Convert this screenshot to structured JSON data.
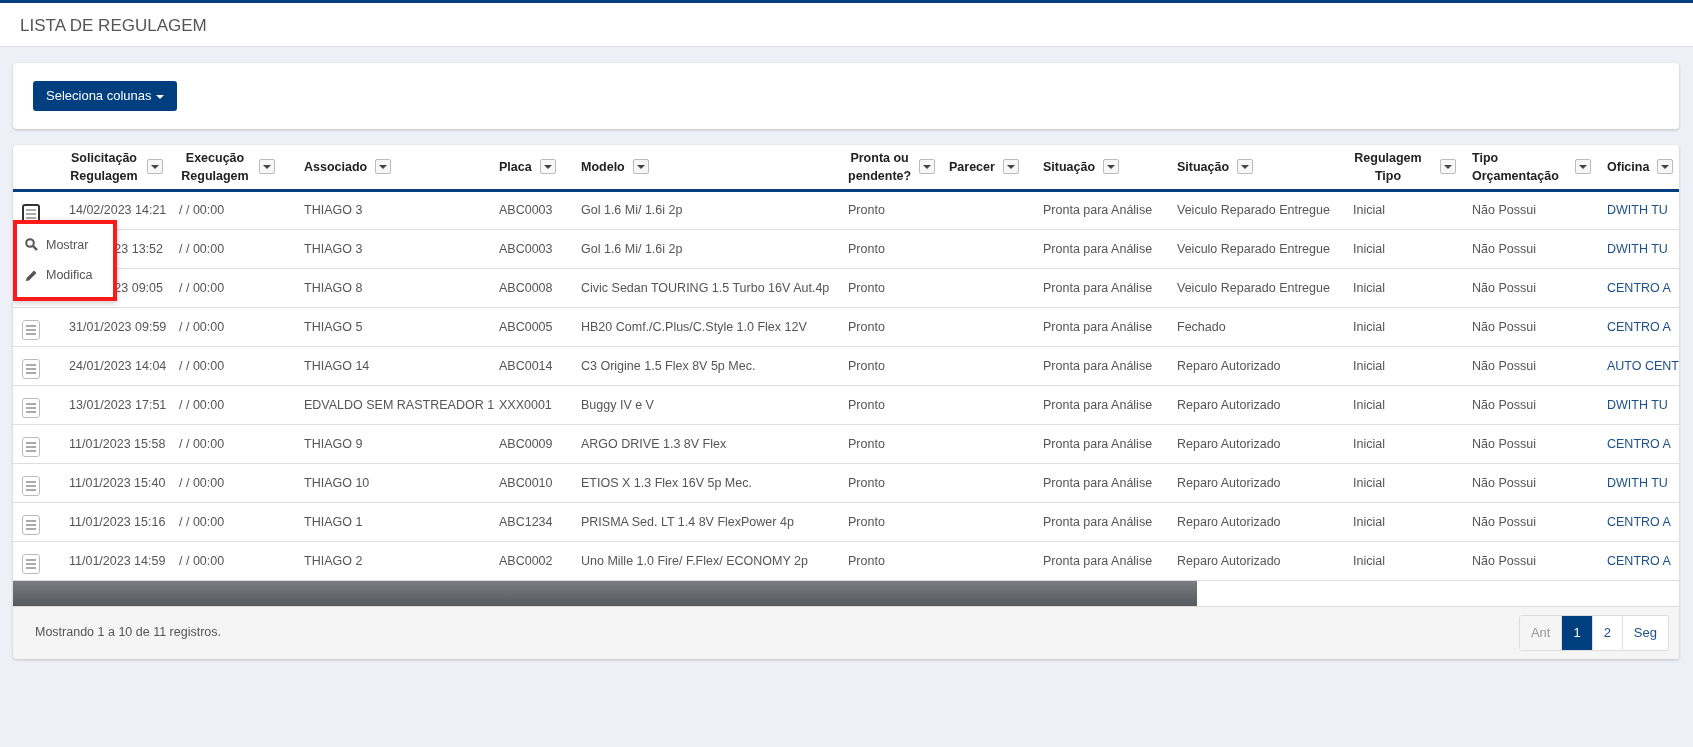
{
  "page_title": "LISTA DE REGULAGEM",
  "columns_button": "Seleciona colunas",
  "columns": [
    {
      "label": "Solicitação Regulagem"
    },
    {
      "label": "Execução Regulagem"
    },
    {
      "label": "Associado"
    },
    {
      "label": "Placa"
    },
    {
      "label": "Modelo"
    },
    {
      "label": "Pronta ou pendente?"
    },
    {
      "label": "Parecer"
    },
    {
      "label": "Situação"
    },
    {
      "label": "Situação"
    },
    {
      "label": "Regulagem Tipo"
    },
    {
      "label": "Tipo Orçamentação"
    },
    {
      "label": "Oficina"
    }
  ],
  "rows": [
    {
      "menu_open": true,
      "cells": [
        "14/02/2023 14:21",
        "/ / 00:00",
        "THIAGO 3",
        "ABC0003",
        "Gol 1.6 Mi/ 1.6i 2p",
        "Pronto",
        "",
        "Pronta para Análise",
        "Veiculo Reparado Entregue",
        "Inicial",
        "Não Possui",
        "DWITH TU"
      ]
    },
    {
      "cells": [
        "23 13:52",
        "/ / 00:00",
        "THIAGO 3",
        "ABC0003",
        "Gol 1.6 Mi/ 1.6i 2p",
        "Pronto",
        "",
        "Pronta para Análise",
        "Veiculo Reparado Entregue",
        "Inicial",
        "Não Possui",
        "DWITH TU"
      ]
    },
    {
      "cells": [
        "23 09:05",
        "/ / 00:00",
        "THIAGO 8",
        "ABC0008",
        "Civic Sedan TOURING 1.5 Turbo 16V Aut.4p",
        "Pronto",
        "",
        "Pronta para Análise",
        "Veiculo Reparado Entregue",
        "Inicial",
        "Não Possui",
        "CENTRO A"
      ]
    },
    {
      "menu_open": false,
      "cells": [
        "31/01/2023 09:59",
        "/ / 00:00",
        "THIAGO 5",
        "ABC0005",
        "HB20 Comf./C.Plus/C.Style 1.0 Flex 12V",
        "Pronto",
        "",
        "Pronta para Análise",
        "Fechado",
        "Inicial",
        "Não Possui",
        "CENTRO A"
      ]
    },
    {
      "menu_open": false,
      "cells": [
        "24/01/2023 14:04",
        "/ / 00:00",
        "THIAGO 14",
        "ABC0014",
        "C3 Origine 1.5 Flex 8V 5p Mec.",
        "Pronto",
        "",
        "Pronta para Análise",
        "Reparo Autorizado",
        "Inicial",
        "Não Possui",
        "AUTO CENT"
      ]
    },
    {
      "menu_open": false,
      "cells": [
        "13/01/2023 17:51",
        "/ / 00:00",
        "EDVALDO SEM RASTREADOR 1",
        "XXX0001",
        "Buggy IV e V",
        "Pronto",
        "",
        "Pronta para Análise",
        "Reparo Autorizado",
        "Inicial",
        "Não Possui",
        "DWITH TU"
      ]
    },
    {
      "menu_open": false,
      "cells": [
        "11/01/2023 15:58",
        "/ / 00:00",
        "THIAGO 9",
        "ABC0009",
        "ARGO DRIVE 1.3 8V Flex",
        "Pronto",
        "",
        "Pronta para Análise",
        "Reparo Autorizado",
        "Inicial",
        "Não Possui",
        "CENTRO A"
      ]
    },
    {
      "menu_open": false,
      "cells": [
        "11/01/2023 15:40",
        "/ / 00:00",
        "THIAGO 10",
        "ABC0010",
        "ETIOS X 1.3 Flex 16V 5p Mec.",
        "Pronto",
        "",
        "Pronta para Análise",
        "Reparo Autorizado",
        "Inicial",
        "Não Possui",
        "DWITH TU"
      ]
    },
    {
      "menu_open": false,
      "cells": [
        "11/01/2023 15:16",
        "/ / 00:00",
        "THIAGO 1",
        "ABC1234",
        "PRISMA Sed. LT 1.4 8V FlexPower 4p",
        "Pronto",
        "",
        "Pronta para Análise",
        "Reparo Autorizado",
        "Inicial",
        "Não Possui",
        "CENTRO A"
      ]
    },
    {
      "menu_open": false,
      "cells": [
        "11/01/2023 14:59",
        "/ / 00:00",
        "THIAGO 2",
        "ABC0002",
        "Uno Mille 1.0 Fire/ F.Flex/ ECONOMY 2p",
        "Pronto",
        "",
        "Pronta para Análise",
        "Reparo Autorizado",
        "Inicial",
        "Não Possui",
        "CENTRO A"
      ]
    }
  ],
  "row_menu": [
    {
      "kind": "show",
      "label": "Mostrar"
    },
    {
      "kind": "edit",
      "label": "Modifica"
    }
  ],
  "footer_info": "Mostrando 1 a 10 de 11 registros.",
  "pagination": [
    {
      "label": "Ant",
      "selected": false,
      "disabled": true
    },
    {
      "label": "1",
      "selected": true,
      "disabled": false
    },
    {
      "label": "2",
      "selected": false,
      "disabled": false
    },
    {
      "label": "Seg",
      "selected": false,
      "disabled": false
    }
  ]
}
